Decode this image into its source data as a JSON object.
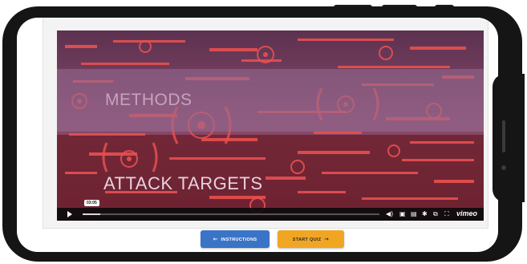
{
  "video": {
    "line_1": "METHODS",
    "line_2": "ATTACK TARGETS",
    "timestamp": "03:05",
    "progress_fraction": 0.06,
    "brand": "vimeo",
    "controls": {
      "volume_icon": "volume-icon",
      "captions_icon": "captions-icon",
      "speed_icon": "speed-icon",
      "settings_icon": "settings-icon",
      "pip_icon": "picture-in-picture-icon",
      "fullscreen_icon": "fullscreen-icon"
    }
  },
  "buttons": {
    "back_arrow": "←",
    "instructions_label": "INSTRUCTIONS",
    "start_quiz_label": "START QUIZ",
    "forward_arrow": "→"
  },
  "colors": {
    "instructions_button": "#3a74c6",
    "start_quiz_button": "#f1a623",
    "video_overlay_red": "#e8504f"
  }
}
